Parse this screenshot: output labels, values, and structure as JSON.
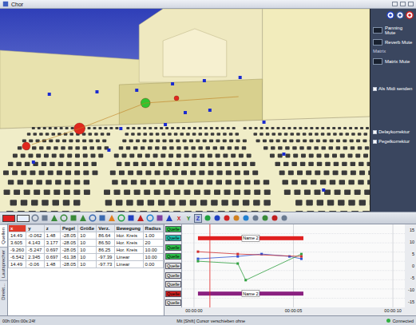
{
  "window": {
    "title": "Chor"
  },
  "side_panel": {
    "toggles_top": [
      {
        "label": "Panning Mute",
        "on": false
      },
      {
        "label": "Reverb Mute",
        "on": false
      }
    ],
    "heading": "Matrix",
    "toggles_bottom": [
      {
        "label": "Matrix Mute",
        "on": false
      }
    ],
    "checkboxes": [
      {
        "label": "Als Midi senden",
        "checked": false
      },
      {
        "label": "Delaykorrektur",
        "checked": false
      },
      {
        "label": "Pegelkorrektur",
        "checked": false
      }
    ]
  },
  "scene": {
    "sources": [
      {
        "color": "#e0281e"
      },
      {
        "color": "#e0281e"
      },
      {
        "color": "#2fc42f"
      },
      {
        "color": "#e0281e"
      }
    ]
  },
  "toolbar": {
    "axes": [
      {
        "label": "X",
        "selected": false,
        "color": "#d02020"
      },
      {
        "label": "Y",
        "selected": false,
        "color": "#208020"
      },
      {
        "label": "Z",
        "selected": true,
        "color": "#2030c0"
      }
    ]
  },
  "view_tabs": [
    {
      "label": "Quellen",
      "selected": true
    },
    {
      "label": "Lautsprecher",
      "selected": false
    },
    {
      "label": "Direkt...",
      "selected": false
    }
  ],
  "table": {
    "columns": [
      "x",
      "y",
      "z",
      "Pegel",
      "Größe",
      "Verz.",
      "Bewegung",
      "Radius"
    ],
    "rows": [
      {
        "cells": [
          "14.49",
          "-0.062",
          "1.48",
          "-28.05",
          "10",
          "86.64",
          "Hor. Kreis",
          "1.00"
        ]
      },
      {
        "cells": [
          "3.605",
          "4.143",
          "3.177",
          "-28.05",
          "10",
          "86.50",
          "Hor. Kreis",
          "20"
        ]
      },
      {
        "cells": [
          "-9.260",
          "-5.247",
          "0.697",
          "-28.05",
          "10",
          "86.25",
          "Hor. Kreis",
          "10.00"
        ]
      },
      {
        "cells": [
          "-6.542",
          "2.345",
          "0.697",
          "-61.38",
          "10",
          "-97.39",
          "Linear",
          "10.00"
        ]
      },
      {
        "cells": [
          "14.49",
          "-0.06",
          "1.48",
          "-28.05",
          "10",
          "-97.73",
          "Linear",
          "0.00"
        ]
      }
    ]
  },
  "timeline": {
    "lanes": [
      {
        "label": "Quelle",
        "color": "#2ec24a"
      },
      {
        "label": "Quelle",
        "color": "#20c0b0"
      },
      {
        "label": "Quelle",
        "color": "#2ec24a"
      },
      {
        "label": "Quelle",
        "color": "#2ec24a"
      },
      {
        "label": "Quelle",
        "color": "#e4e4e4"
      },
      {
        "label": "Quelle",
        "color": "#e4e4e4"
      },
      {
        "label": "Quelle",
        "color": "#e4e4e4"
      },
      {
        "label": "Quelle",
        "color": "#d02020"
      },
      {
        "label": "Quelle",
        "color": "#e4e4e4"
      }
    ],
    "bars": [
      {
        "label": "Name 2",
        "color": "#e02020",
        "lane": 1,
        "start": 0.2,
        "end": 5.5
      },
      {
        "label": "Name 2",
        "color": "#8a2080",
        "lane": 7,
        "start": 0.2,
        "end": 5.5
      }
    ],
    "series": [
      {
        "color": "#3050d0",
        "times": [
          0.2,
          2.2,
          3.4,
          4.8,
          5.4
        ],
        "values": [
          3,
          4,
          5,
          4,
          3
        ]
      },
      {
        "color": "#30a040",
        "times": [
          0.2,
          2.2,
          2.6,
          5.4
        ],
        "values": [
          2,
          1,
          -6,
          5
        ]
      },
      {
        "color": "#d03030",
        "times": [
          0.2,
          2.2,
          5.4
        ],
        "values": [
          6,
          5,
          4
        ]
      }
    ],
    "y_ticks": [
      "15",
      "10",
      "5",
      "0",
      "-5",
      "-10",
      "-15"
    ],
    "x_ticks": [
      {
        "label": "00:00:00",
        "time": 0
      },
      {
        "label": "00:00:05",
        "time": 5
      },
      {
        "label": "00:00:10",
        "time": 10
      }
    ],
    "cursor": 0.8
  },
  "status_bar": {
    "time": "00h:00m:00s:24f",
    "hint": "Mit [Shift] Cursor verschieben ohne",
    "connection": "Connected"
  }
}
